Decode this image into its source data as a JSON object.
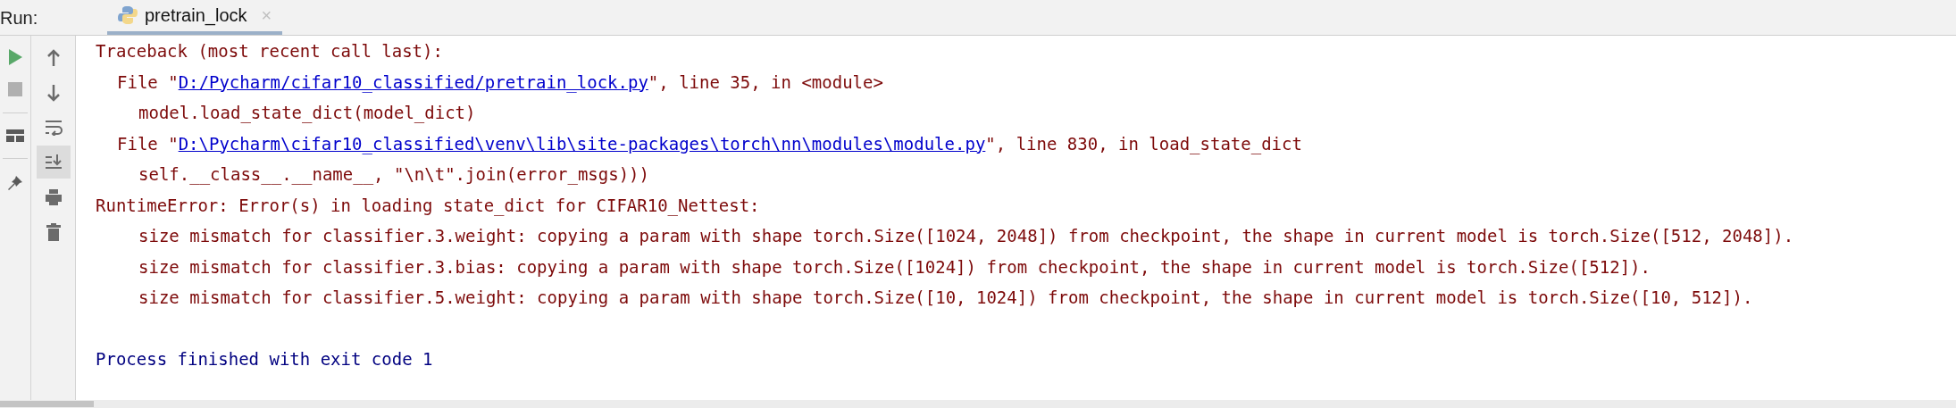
{
  "run_label": "Run:",
  "tab": {
    "title": "pretrain_lock",
    "selected": true,
    "close": "×"
  },
  "toolbar_left": [
    {
      "kind": "run",
      "disabled": false
    },
    {
      "kind": "stop",
      "disabled": true
    },
    {
      "kind": "layout",
      "disabled": false
    },
    {
      "kind": "pin",
      "disabled": false
    }
  ],
  "toolbar_right": [
    {
      "kind": "up",
      "on": false
    },
    {
      "kind": "down",
      "on": false
    },
    {
      "kind": "wrap",
      "on": false
    },
    {
      "kind": "scroll-end",
      "on": true
    },
    {
      "kind": "print",
      "on": false
    },
    {
      "kind": "trash",
      "on": false
    }
  ],
  "console_lines": [
    {
      "kind": "error",
      "text": "Traceback (most recent call last):"
    },
    {
      "kind": "file",
      "prefix": "File \"",
      "link": "D:/Pycharm/cifar10_classified/pretrain_lock.py",
      "suffix": "\", line 35, in <module>"
    },
    {
      "kind": "code",
      "text": "model.load_state_dict(model_dict)"
    },
    {
      "kind": "file",
      "prefix": "File \"",
      "link": "D:\\Pycharm\\cifar10_classified\\venv\\lib\\site-packages\\torch\\nn\\modules\\module.py",
      "suffix": "\", line 830, in load_state_dict"
    },
    {
      "kind": "code",
      "text": "self.__class__.__name__, \"\\n\\t\".join(error_msgs)))"
    },
    {
      "kind": "error",
      "text": "RuntimeError: Error(s) in loading state_dict for CIFAR10_Nettest:"
    },
    {
      "kind": "code",
      "text": "size mismatch for classifier.3.weight: copying a param with shape torch.Size([1024, 2048]) from checkpoint, the shape in current model is torch.Size([512, 2048])."
    },
    {
      "kind": "code",
      "text": "size mismatch for classifier.3.bias: copying a param with shape torch.Size([1024]) from checkpoint, the shape in current model is torch.Size([512])."
    },
    {
      "kind": "code",
      "text": "size mismatch for classifier.5.weight: copying a param with shape torch.Size([10, 1024]) from checkpoint, the shape in current model is torch.Size([10, 512])."
    },
    {
      "kind": "blank"
    },
    {
      "kind": "exit",
      "text": "Process finished with exit code 1"
    }
  ]
}
